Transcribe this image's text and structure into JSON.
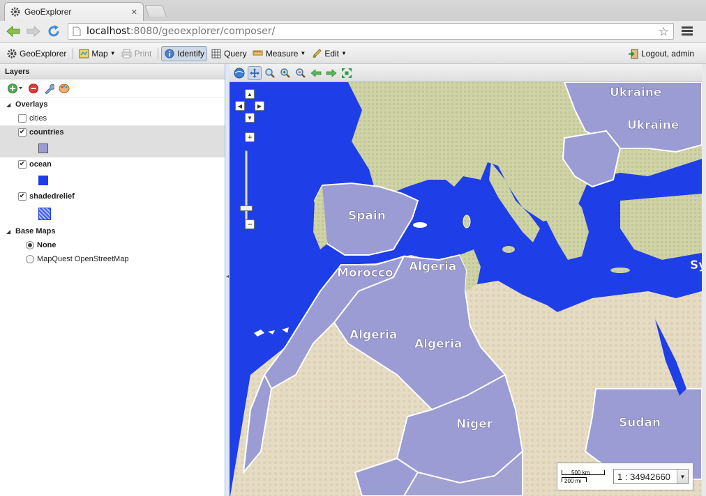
{
  "browser": {
    "tab_title": "GeoExplorer",
    "url_host": "localhost",
    "url_rest": ":8080/geoexplorer/composer/"
  },
  "app_toolbar": {
    "app_name": "GeoExplorer",
    "map_label": "Map",
    "print_label": "Print",
    "identify_label": "Identify",
    "query_label": "Query",
    "measure_label": "Measure",
    "edit_label": "Edit",
    "logout_label": "Logout, admin"
  },
  "layers_panel": {
    "title": "Layers",
    "overlays_label": "Overlays",
    "overlays": [
      {
        "label": "cities",
        "checked": false,
        "bold": false
      },
      {
        "label": "countries",
        "checked": true,
        "bold": true,
        "legend_color": "#9b9cd4"
      },
      {
        "label": "ocean",
        "checked": true,
        "bold": true,
        "legend_color": "#1e3ee8"
      },
      {
        "label": "shadedrelief",
        "checked": true,
        "bold": true,
        "legend_color": "#3f5ef0"
      }
    ],
    "basemaps_label": "Base Maps",
    "basemaps": [
      {
        "label": "None",
        "selected": true
      },
      {
        "label": "MapQuest OpenStreetMap",
        "selected": false
      }
    ]
  },
  "map": {
    "country_labels": {
      "ukraine1": "Ukraine",
      "ukraine2": "Ukraine",
      "spain": "Spain",
      "morocco": "Morocco",
      "algeria1": "Algeria",
      "algeria2": "Algeria",
      "algeria3": "Algeria",
      "niger": "Niger",
      "sudan": "Sudan",
      "syria": "Sy"
    },
    "scale_km": "500 km",
    "scale_mi": "200 mi",
    "scale_value": "1 : 34942660"
  },
  "colors": {
    "ocean": "#1e3ee8",
    "country": "#9b9cd4",
    "land": "#cdd0a8"
  }
}
